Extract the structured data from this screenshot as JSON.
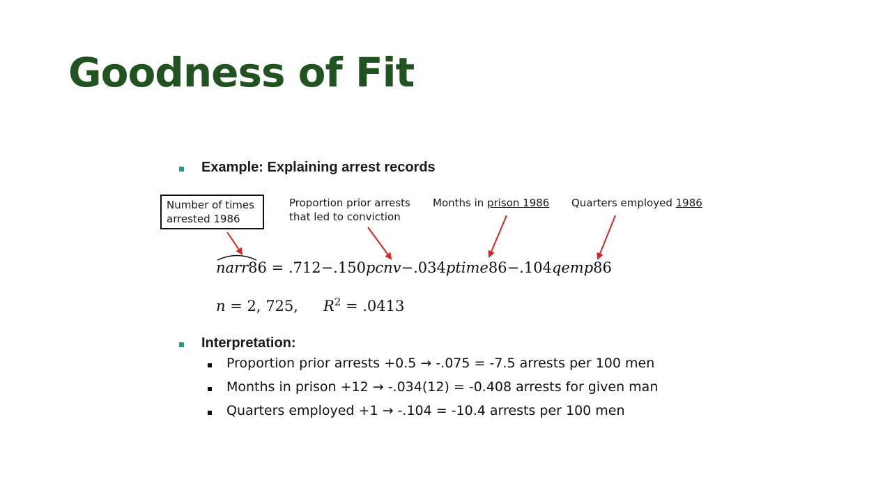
{
  "slide": {
    "title": "Goodness of Fit"
  },
  "example": {
    "heading": "Example: Explaining arrest records",
    "annotations": {
      "narr": [
        "Number of times",
        "arrested 1986"
      ],
      "pcnv": [
        "Proportion prior arrests",
        "that led to conviction"
      ],
      "ptime_prefix": "Months in ",
      "ptime_underlined": "prison 1986",
      "qemp_prefix": "Quarters employed ",
      "qemp_underlined": "1986"
    },
    "equation": {
      "lhs_var": "narr",
      "lhs_num": "86",
      "eq_sign": " = ",
      "intercept": ".712",
      "term1_coef": "−.150",
      "term1_var": "pcnv",
      "term2_coef": "−.034",
      "term2_var": "ptime",
      "term2_num": "86",
      "term3_coef": "−.104",
      "term3_var": "qemp",
      "term3_num": "86"
    },
    "stats": {
      "n_var": "n",
      "n_value": " = 2, 725,",
      "r_var": "R",
      "r_exp": "2",
      "r_value": " = .0413"
    }
  },
  "interpretation": {
    "heading": "Interpretation:",
    "items": [
      "Proportion prior arrests +0.5 → -.075 = -7.5 arrests per 100 men",
      "Months in prison +12 → -.034(12) = -0.408 arrests for given man",
      "Quarters employed +1 → -.104 = -10.4 arrests per 100 men"
    ]
  },
  "colors": {
    "title": "#215321",
    "bullet": "#1a9e8f",
    "arrow": "#e02020"
  }
}
